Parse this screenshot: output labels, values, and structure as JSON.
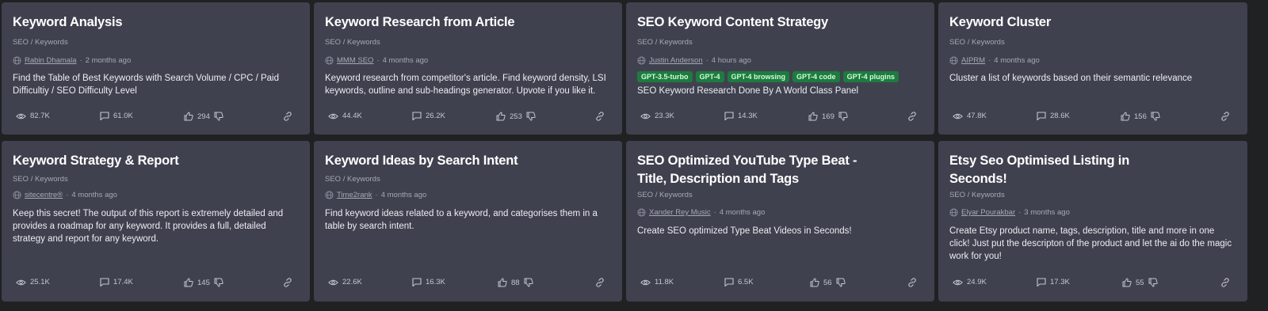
{
  "cards": [
    {
      "title": "Keyword Analysis",
      "category": "SEO / Keywords",
      "author": "Rabin Dhamala",
      "time": "2 months ago",
      "tags": [],
      "description": "Find the Table of Best Keywords with Search Volume / CPC / Paid Difficultiy / SEO Difficulty Level",
      "views": "82.7K",
      "comments": "61.0K",
      "likes": "294"
    },
    {
      "title": "Keyword Research from Article",
      "category": "SEO / Keywords",
      "author": "MMM SEO",
      "time": "4 months ago",
      "tags": [],
      "description": "Keyword research from competitor's article. Find keyword density, LSI keywords, outline and sub-headings generator. Upvote if you like it.",
      "views": "44.4K",
      "comments": "26.2K",
      "likes": "253"
    },
    {
      "title": "SEO Keyword Content Strategy",
      "category": "SEO / Keywords",
      "author": "Justin Anderson",
      "time": "4 hours ago",
      "tags": [
        "GPT-3.5-turbo",
        "GPT-4",
        "GPT-4 browsing",
        "GPT-4 code",
        "GPT-4 plugins"
      ],
      "description": "SEO Keyword Research Done By A World Class Panel",
      "views": "23.3K",
      "comments": "14.3K",
      "likes": "169"
    },
    {
      "title": "Keyword Cluster",
      "category": "SEO / Keywords",
      "author": "AIPRM",
      "time": "4 months ago",
      "tags": [],
      "description": "Cluster a list of keywords based on their semantic relevance",
      "views": "47.8K",
      "comments": "28.6K",
      "likes": "156"
    },
    {
      "title": "Keyword Strategy & Report",
      "category": "SEO / Keywords",
      "author": "sitecentre®",
      "time": "4 months ago",
      "tags": [],
      "description": "Keep this secret! The output of this report is extremely detailed and provides a roadmap for any keyword. It provides a full, detailed strategy and report for any keyword.",
      "views": "25.1K",
      "comments": "17.4K",
      "likes": "145"
    },
    {
      "title": "Keyword Ideas by Search Intent",
      "category": "SEO / Keywords",
      "author": "Time2rank",
      "time": "4 months ago",
      "tags": [],
      "description": "Find keyword ideas related to a keyword, and categorises them in a table by search intent.",
      "views": "22.6K",
      "comments": "16.3K",
      "likes": "88"
    },
    {
      "title": "SEO Optimized YouTube Type Beat - Title, Description and Tags",
      "category": "SEO / Keywords",
      "author": "Xander Rey Music",
      "time": "4 months ago",
      "tags": [],
      "description": "Create SEO optimized Type Beat Videos in Seconds!",
      "views": "11.8K",
      "comments": "6.5K",
      "likes": "56"
    },
    {
      "title": "Etsy Seo Optimised Listing in Seconds!",
      "category": "SEO / Keywords",
      "author": "Elyar Pourakbar",
      "time": "3 months ago",
      "tags": [],
      "description": "Create Etsy product name, tags, description, title and more in one click! Just put the descripton of the product and let the ai do the magic work for you!",
      "views": "24.9K",
      "comments": "17.3K",
      "likes": "55"
    }
  ]
}
